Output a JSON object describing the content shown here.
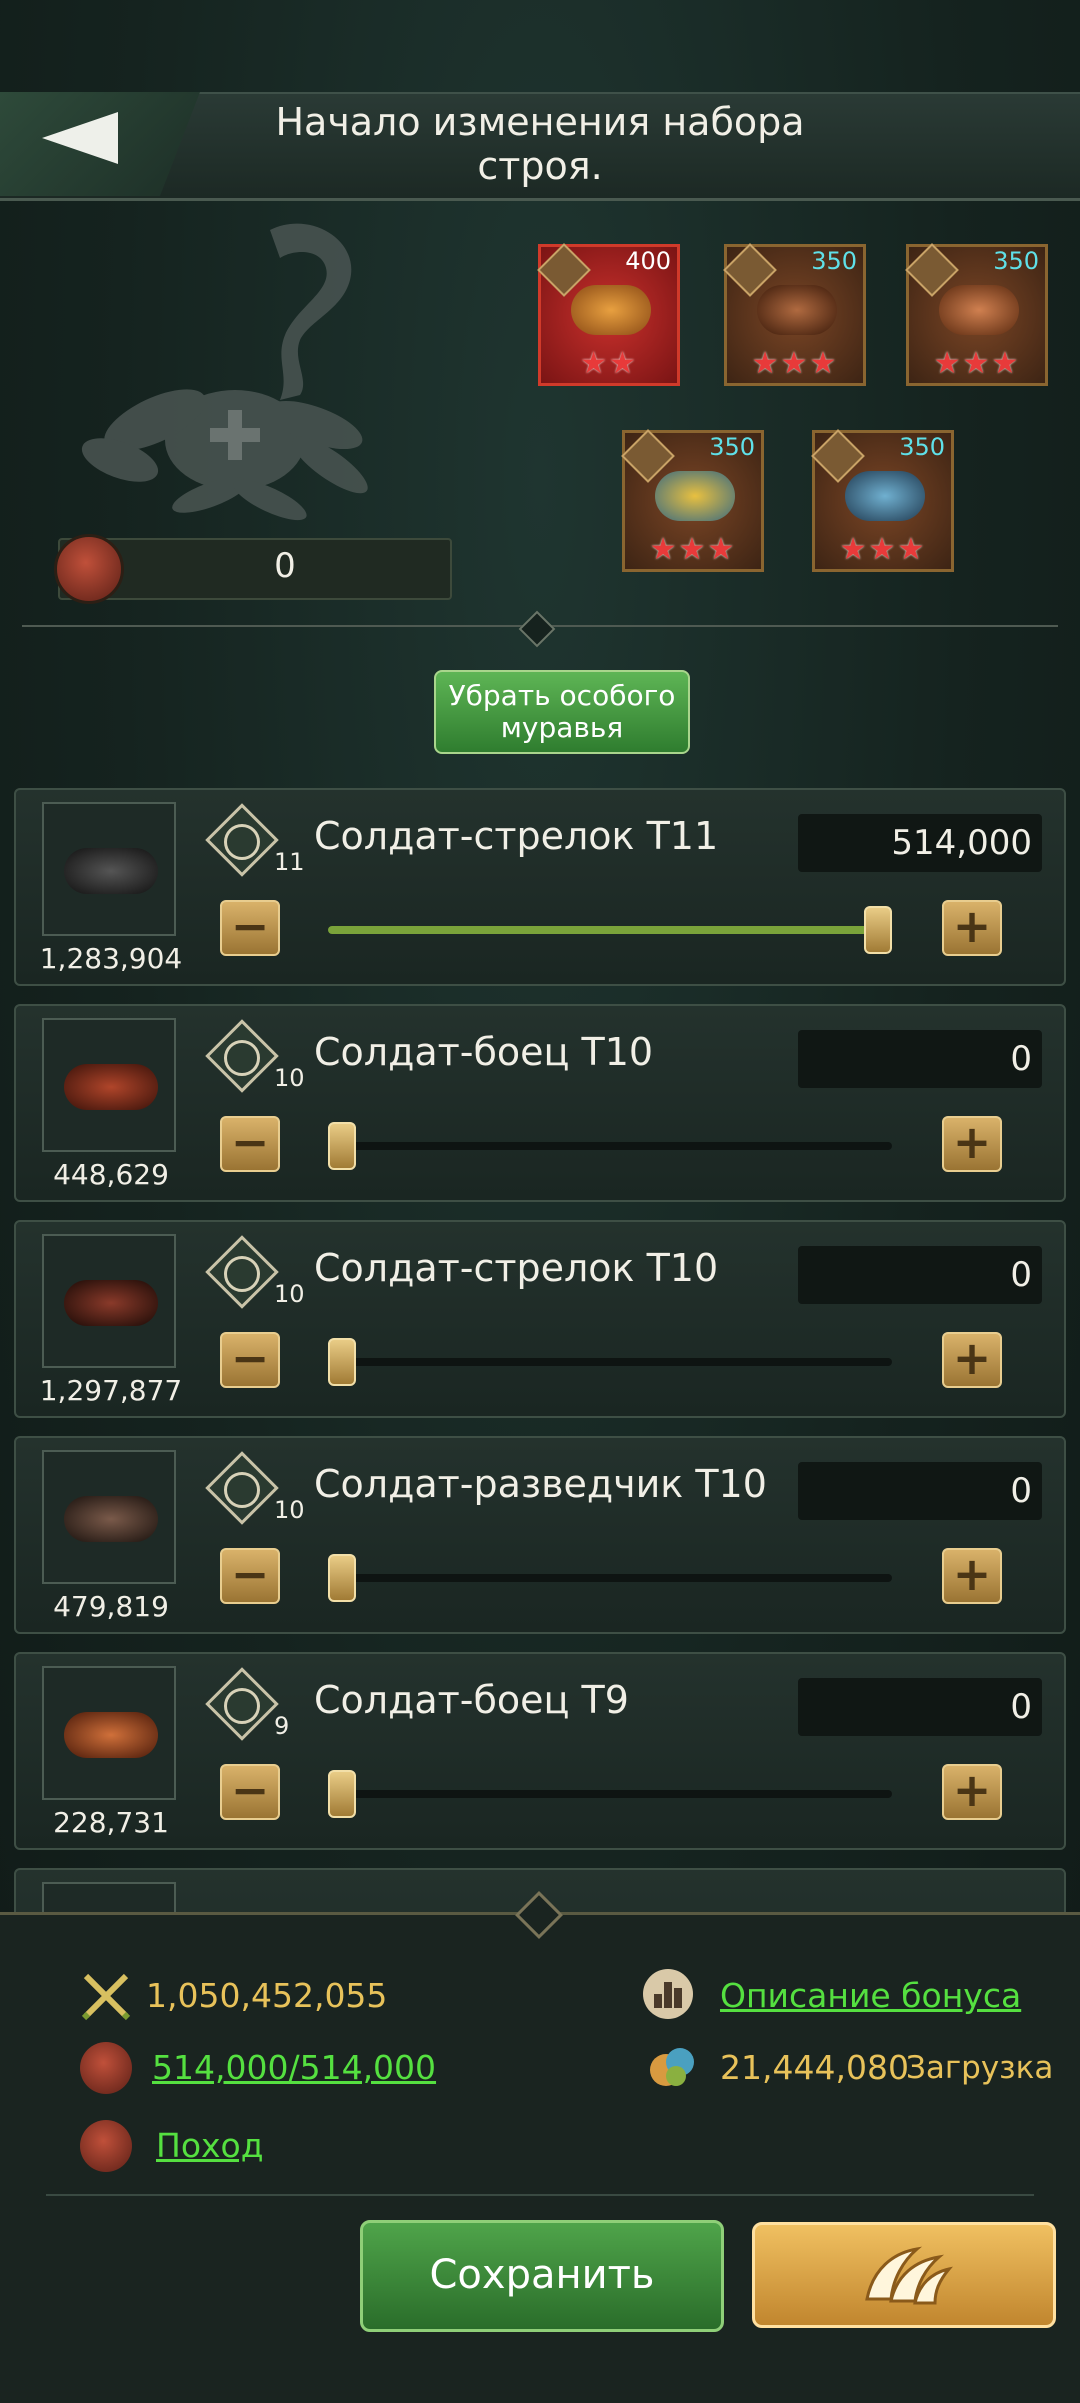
{
  "header": {
    "title_line1": "Начало изменения набора",
    "title_line2": "строя."
  },
  "formation": {
    "special_ant_count": "0",
    "cards": [
      {
        "level": "400",
        "stars": "★★",
        "highlight": true
      },
      {
        "level": "350",
        "stars": "★★★",
        "highlight": false
      },
      {
        "level": "350",
        "stars": "★★★",
        "highlight": false
      },
      {
        "level": "350",
        "stars": "★★★",
        "highlight": false
      },
      {
        "level": "350",
        "stars": "★★★",
        "highlight": false
      }
    ]
  },
  "remove_button": {
    "line1": "Убрать особого",
    "line2": "муравья"
  },
  "troops": [
    {
      "name": "Солдат-стрелок T11",
      "tier": "11",
      "type_icon": "shooter-icon",
      "owned": "1,283,904",
      "quantity": "514,000",
      "fraction": 1.0
    },
    {
      "name": "Солдат-боец T10",
      "tier": "10",
      "type_icon": "shield-icon",
      "owned": "448,629",
      "quantity": "0",
      "fraction": 0
    },
    {
      "name": "Солдат-стрелок T10",
      "tier": "10",
      "type_icon": "shooter-icon",
      "owned": "1,297,877",
      "quantity": "0",
      "fraction": 0
    },
    {
      "name": "Солдат-разведчик T10",
      "tier": "10",
      "type_icon": "scout-icon",
      "owned": "479,819",
      "quantity": "0",
      "fraction": 0
    },
    {
      "name": "Солдат-боец T9",
      "tier": "9",
      "type_icon": "shield-icon",
      "owned": "228,731",
      "quantity": "0",
      "fraction": 0
    }
  ],
  "summary": {
    "power": "1,050,452,055",
    "troop_capacity": "514,000/514,000",
    "march_link": "Поход",
    "bonus_link": "Описание бонуса",
    "load_value": "21,444,080",
    "load_label": "Загрузка"
  },
  "buttons": {
    "save": "Сохранить"
  },
  "colors": {
    "accent_green": "#5eb555",
    "link_green": "#55e040",
    "gold": "#e8c25a",
    "card_border": "#8a6530",
    "highlight_red": "#c8302c"
  }
}
